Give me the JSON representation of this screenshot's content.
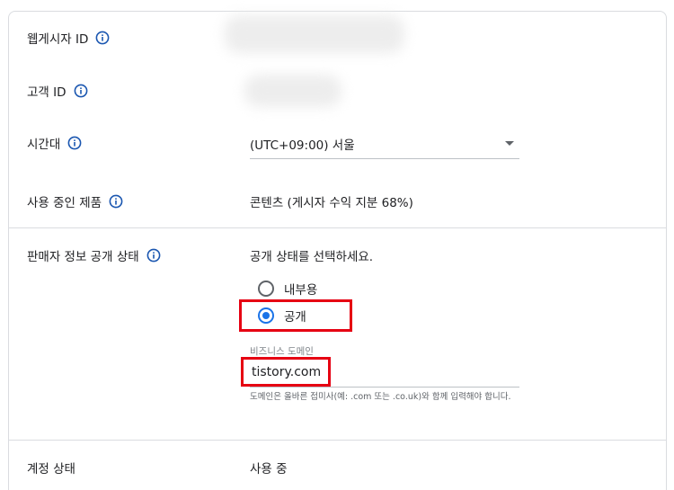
{
  "publisher_id": {
    "label": "웹게시자 ID"
  },
  "customer_id": {
    "label": "고객 ID"
  },
  "timezone": {
    "label": "시간대",
    "value": "(UTC+09:00) 서울"
  },
  "products": {
    "label": "사용 중인 제품",
    "value": "콘텐츠 (게시자 수익 지분 68%)"
  },
  "seller_info": {
    "label": "판매자 정보 공개 상태",
    "prompt": "공개 상태를 선택하세요.",
    "options": [
      {
        "label": "내부용",
        "selected": false
      },
      {
        "label": "공개",
        "selected": true
      }
    ],
    "domain_field": {
      "label": "비즈니스 도메인",
      "value": "tistory.com",
      "help": "도메인은 올바른 접미사(예: .com 또는 .co.uk)와 함께 입력해야 합니다."
    }
  },
  "account_status": {
    "label": "계정 상태",
    "value": "사용 중"
  },
  "icons": {
    "info": "info-circle-icon",
    "dropdown": "caret-down-icon"
  },
  "colors": {
    "accent": "#1a73e8",
    "highlight": "#e60012",
    "divider": "#dadce0"
  }
}
